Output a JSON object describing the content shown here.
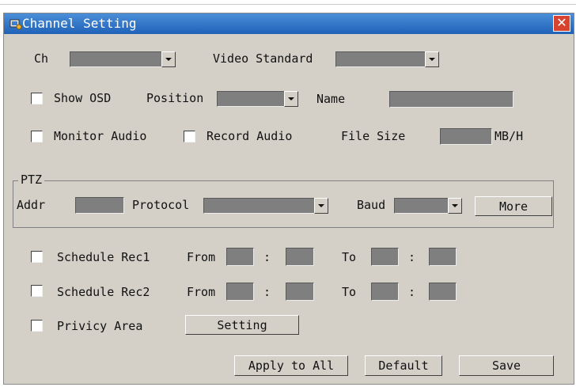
{
  "window": {
    "title": "Channel Setting",
    "close_icon": "close-icon"
  },
  "row1": {
    "ch_label": "Ch",
    "video_standard_label": "Video Standard"
  },
  "row2": {
    "show_osd_label": "Show OSD",
    "position_label": "Position",
    "name_label": "Name"
  },
  "row3": {
    "monitor_audio_label": "Monitor Audio",
    "record_audio_label": "Record Audio",
    "file_size_label": "File Size",
    "file_size_unit": "MB/H"
  },
  "ptz": {
    "group_label": "PTZ",
    "addr_label": "Addr",
    "protocol_label": "Protocol",
    "baud_label": "Baud",
    "more_button": "More"
  },
  "schedule1": {
    "label": "Schedule Rec1",
    "from_label": "From",
    "colon": ":",
    "to_label": "To"
  },
  "schedule2": {
    "label": "Schedule Rec2",
    "from_label": "From",
    "colon": ":",
    "to_label": "To"
  },
  "privacy": {
    "label": "Privicy Area",
    "setting_button": "Setting"
  },
  "footer": {
    "apply_all_button": "Apply to All",
    "default_button": "Default",
    "save_button": "Save"
  },
  "colors": {
    "title_bar": "#1f62b8",
    "dialog_bg": "#d4d0c8",
    "field_fill": "#7f7f7f",
    "close_red": "#d8432f"
  }
}
